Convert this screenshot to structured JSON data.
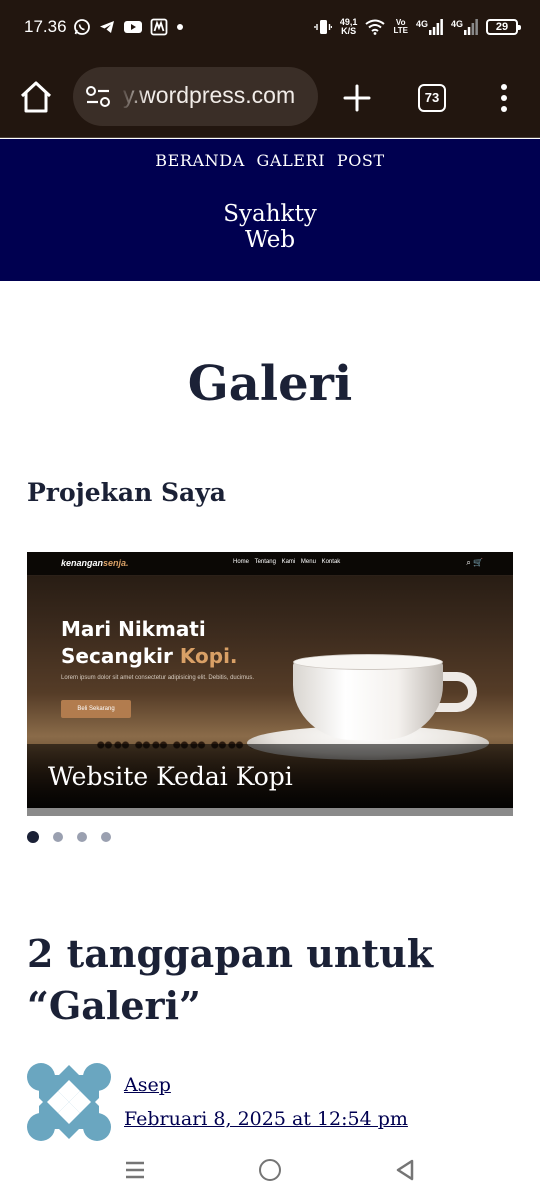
{
  "status_bar": {
    "time": "17.36",
    "net_speed_value": "49,1",
    "net_speed_unit": "K/S",
    "volte_top": "Vo",
    "volte_bottom": "LTE",
    "sim1_label": "4G",
    "sim2_label": "4G",
    "battery": "29"
  },
  "browser": {
    "url": "y.wordpress.com",
    "tab_count": "73"
  },
  "site": {
    "nav": [
      "BERANDA",
      "GALERI",
      "POST"
    ],
    "title_line1": "Syahkty",
    "title_line2": "Web"
  },
  "page": {
    "title": "Galeri",
    "section_heading": "Projekan Saya"
  },
  "slider": {
    "mini_logo_a": "kenangan",
    "mini_logo_b": "senja.",
    "mini_links": "Home Tentang Kami Menu Kontak",
    "mini_icons": "⌕ 🛒",
    "hero_line1": "Mari Nikmati",
    "hero_line2a": "Secangkir ",
    "hero_line2b": "Kopi.",
    "hero_lorem": "Lorem ipsum dolor sit amet consectetur adipisicing elit. Debitis, ducimus.",
    "hero_button": "Beli Sekarang",
    "caption": "Website Kedai Kopi",
    "dot_count": 4,
    "active_dot": 0
  },
  "comments": {
    "title": "2 tanggapan untuk “Galeri”",
    "items": [
      {
        "author": "Asep",
        "date": "Februari 8, 2025 at 12:54 pm"
      }
    ]
  },
  "colors": {
    "header_bg": "#000050",
    "chrome_bg": "#22160f",
    "text": "#1b2136",
    "avatar": "#6aa6c0"
  }
}
